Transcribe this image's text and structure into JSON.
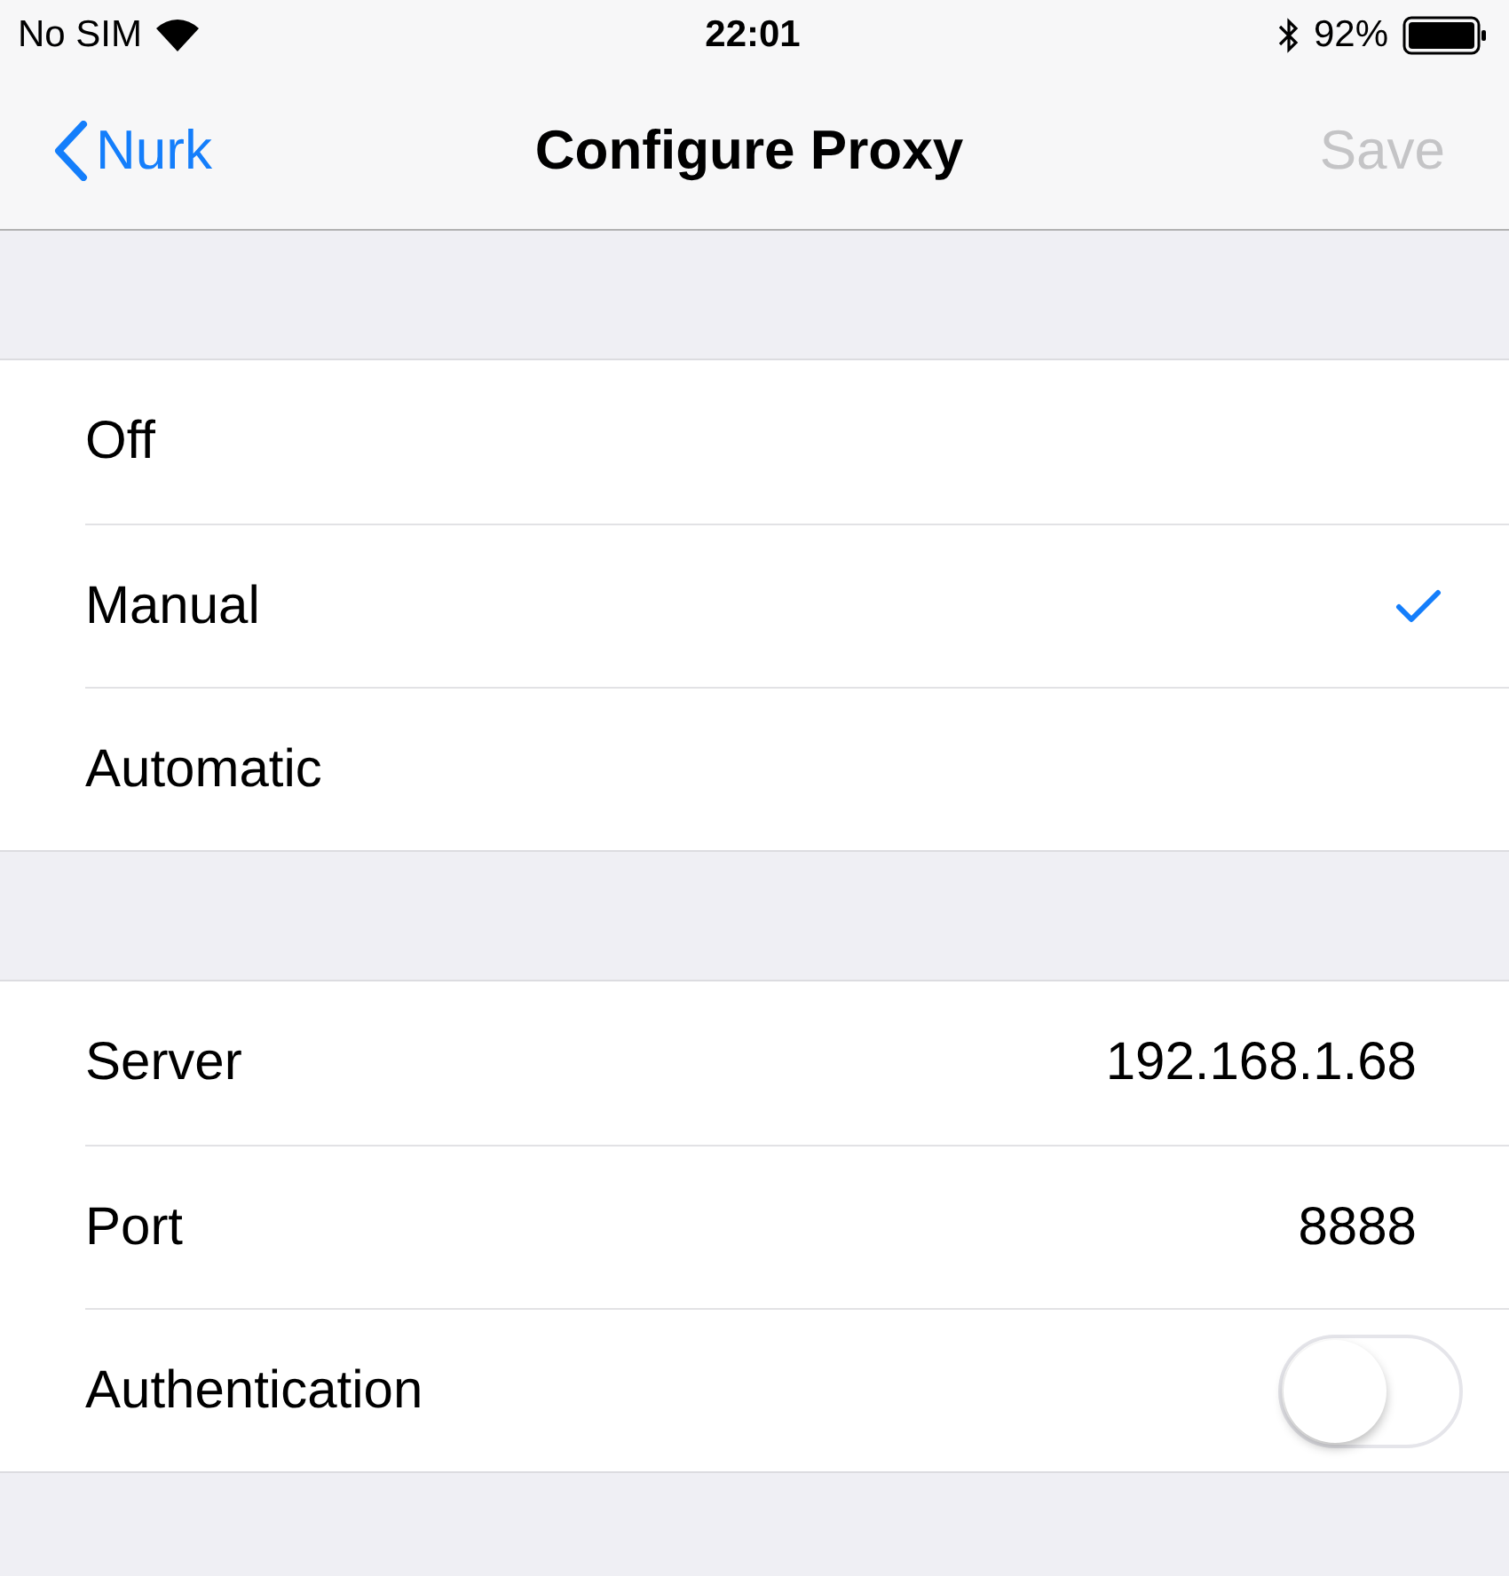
{
  "status_bar": {
    "carrier": "No SIM",
    "time": "22:01",
    "battery": "92%"
  },
  "nav": {
    "back": "Nurk",
    "title": "Configure Proxy",
    "save": {
      "label": "Save",
      "disabled": true
    }
  },
  "modes": [
    {
      "label": "Off",
      "selected": false
    },
    {
      "label": "Manual",
      "selected": true
    },
    {
      "label": "Automatic",
      "selected": false
    }
  ],
  "fields": [
    {
      "kind": "value",
      "label": "Server",
      "value": "192.168.1.68"
    },
    {
      "kind": "value",
      "label": "Port",
      "value": "8888"
    },
    {
      "kind": "toggle",
      "label": "Authentication",
      "on": false
    }
  ]
}
